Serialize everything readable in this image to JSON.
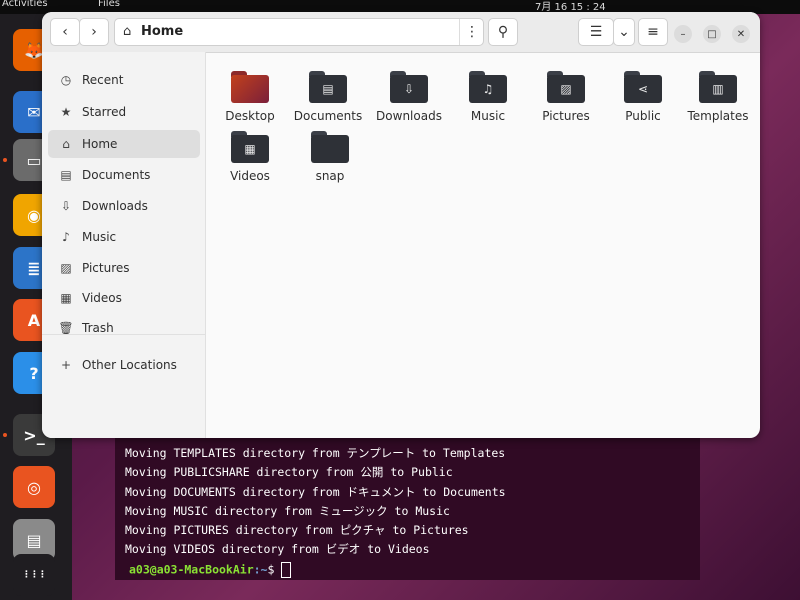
{
  "topbar": {
    "activities": "Activities",
    "files_app": "Files",
    "clock": "7月 16 15 : 24"
  },
  "dock": {
    "items": [
      {
        "name": "firefox",
        "glyph": "🦊",
        "color": "#e66000"
      },
      {
        "name": "thunderbird",
        "glyph": "✉",
        "color": "#2a6fc9"
      },
      {
        "name": "files",
        "glyph": "▭",
        "color": "#6b6b6b"
      },
      {
        "name": "rhythmbox",
        "glyph": "◉",
        "color": "#f0a500"
      },
      {
        "name": "writer",
        "glyph": "≣",
        "color": "#2c74c8"
      },
      {
        "name": "app-center",
        "glyph": "A",
        "color": "#e95420"
      },
      {
        "name": "help",
        "glyph": "?",
        "color": "#2b8fe8"
      },
      {
        "name": "terminal",
        "glyph": ">_",
        "color": "#3a3a3a"
      },
      {
        "name": "ubuntu",
        "glyph": "◎",
        "color": "#e95420"
      },
      {
        "name": "disk",
        "glyph": "▤",
        "color": "#8a8a8a"
      },
      {
        "name": "show-apps",
        "glyph": "⋮⋮⋮",
        "color": "#1f1d21"
      }
    ]
  },
  "window": {
    "path_title": "Home",
    "sidebar": [
      {
        "label": "Recent",
        "icon": "clock-icon",
        "glyph": "◷"
      },
      {
        "label": "Starred",
        "icon": "star-icon",
        "glyph": "★"
      },
      {
        "label": "Home",
        "icon": "home-icon",
        "glyph": "⌂"
      },
      {
        "label": "Documents",
        "icon": "document-icon",
        "glyph": "▤"
      },
      {
        "label": "Downloads",
        "icon": "download-icon",
        "glyph": "⇩"
      },
      {
        "label": "Music",
        "icon": "music-icon",
        "glyph": "♪"
      },
      {
        "label": "Pictures",
        "icon": "picture-icon",
        "glyph": "▨"
      },
      {
        "label": "Videos",
        "icon": "video-icon",
        "glyph": "▦"
      },
      {
        "label": "Trash",
        "icon": "trash-icon",
        "glyph": "🗑"
      }
    ],
    "other_locations": {
      "label": "Other Locations",
      "glyph": "+"
    },
    "folders": [
      {
        "label": "Desktop",
        "glyph": ""
      },
      {
        "label": "Documents",
        "glyph": "▤"
      },
      {
        "label": "Downloads",
        "glyph": "⇩"
      },
      {
        "label": "Music",
        "glyph": "♫"
      },
      {
        "label": "Pictures",
        "glyph": "▨"
      },
      {
        "label": "Public",
        "glyph": "⋖"
      },
      {
        "label": "Templates",
        "glyph": "▥"
      },
      {
        "label": "Videos",
        "glyph": "▦"
      },
      {
        "label": "snap",
        "glyph": ""
      }
    ]
  },
  "terminal": {
    "lines": [
      "Moving TEMPLATES directory from テンプレート to Templates",
      "Moving PUBLICSHARE directory from 公開 to Public",
      "Moving DOCUMENTS directory from ドキュメント to Documents",
      "Moving MUSIC directory from ミュージック to Music",
      "Moving PICTURES directory from ピクチャ to Pictures",
      "Moving VIDEOS directory from ビデオ to Videos"
    ],
    "prompt_user": "a03@a03-MacBookAir",
    "prompt_path": ":~",
    "prompt_symbol": "$ "
  }
}
